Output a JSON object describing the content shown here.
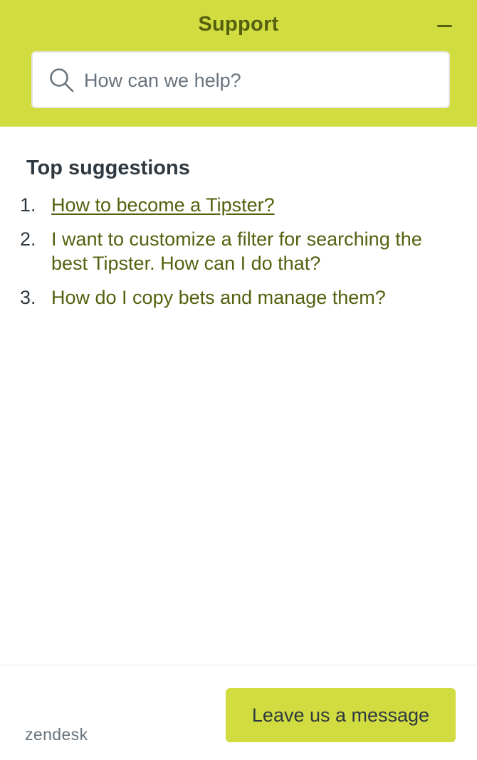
{
  "header": {
    "title": "Support",
    "minimize_icon": "minus-icon"
  },
  "search": {
    "placeholder": "How can we help?",
    "value": "",
    "icon": "search-icon"
  },
  "suggestions": {
    "title": "Top suggestions",
    "items": [
      {
        "number": "1.",
        "label": "How to become a Tipster?"
      },
      {
        "number": "2.",
        "label": "I want to customize a filter for searching the best Tipster. How can I do that?"
      },
      {
        "number": "3.",
        "label": "How do I copy bets and manage them?"
      }
    ]
  },
  "footer": {
    "brand": "zendesk",
    "leave_message_label": "Leave us a message"
  },
  "colors": {
    "brand_accent": "#d1dc40",
    "brand_text": "#55600f",
    "body_text": "#2f3941",
    "muted_text": "#68737d"
  }
}
